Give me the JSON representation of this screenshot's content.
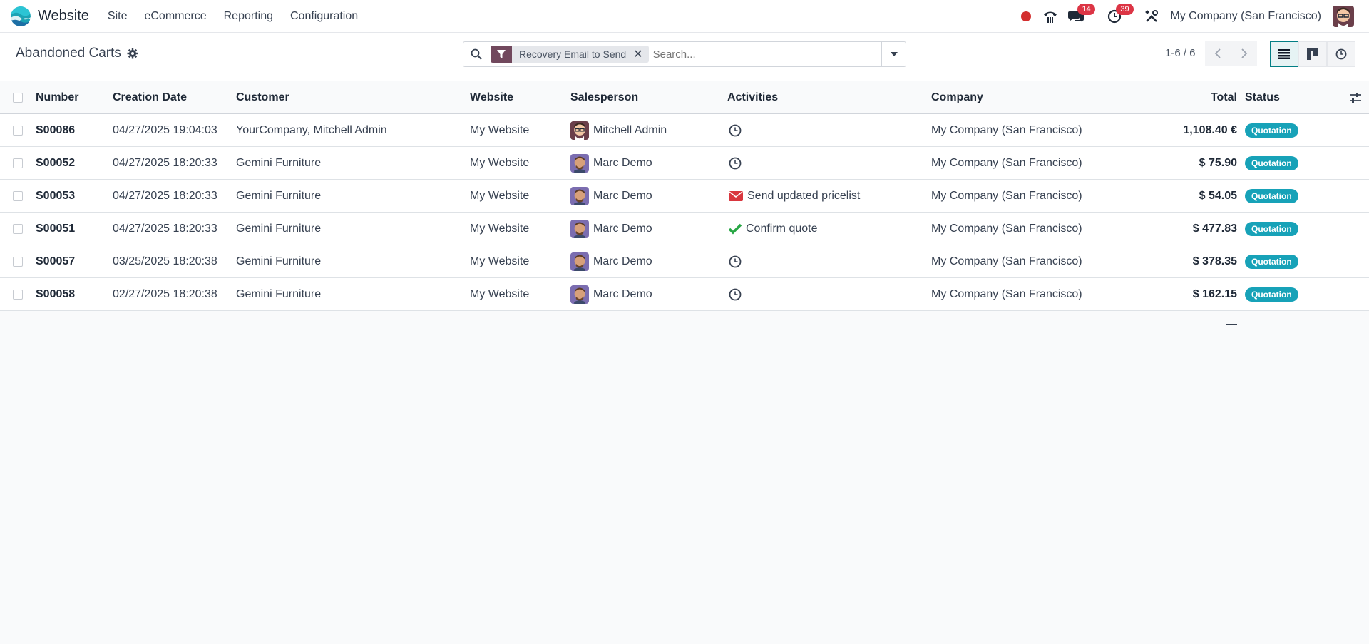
{
  "navbar": {
    "app_name": "Website",
    "menu": [
      "Site",
      "eCommerce",
      "Reporting",
      "Configuration"
    ],
    "messages_count": "14",
    "activities_count": "39",
    "company": "My Company (San Francisco)"
  },
  "control_panel": {
    "title": "Abandoned Carts",
    "facet": "Recovery Email to Send",
    "search_placeholder": "Search...",
    "pager": "1-6 / 6"
  },
  "table": {
    "headers": {
      "number": "Number",
      "creation_date": "Creation Date",
      "customer": "Customer",
      "website": "Website",
      "salesperson": "Salesperson",
      "activities": "Activities",
      "company": "Company",
      "total": "Total",
      "status": "Status"
    },
    "rows": [
      {
        "number": "S00086",
        "date": "04/27/2025 19:04:03",
        "customer": "YourCompany, Mitchell Admin",
        "website": "My Website",
        "salesperson": "Mitchell Admin",
        "avatar": "mitchell",
        "activity_icon": "clock-icon",
        "activity_text": "",
        "company": "My Company (San Francisco)",
        "total": "1,108.40 €",
        "status": "Quotation"
      },
      {
        "number": "S00052",
        "date": "04/27/2025 18:20:33",
        "customer": "Gemini Furniture",
        "website": "My Website",
        "salesperson": "Marc Demo",
        "avatar": "marc",
        "activity_icon": "clock-icon",
        "activity_text": "",
        "company": "My Company (San Francisco)",
        "total": "$ 75.90",
        "status": "Quotation"
      },
      {
        "number": "S00053",
        "date": "04/27/2025 18:20:33",
        "customer": "Gemini Furniture",
        "website": "My Website",
        "salesperson": "Marc Demo",
        "avatar": "marc",
        "activity_icon": "envelope-icon",
        "activity_text": "Send updated pricelist",
        "company": "My Company (San Francisco)",
        "total": "$ 54.05",
        "status": "Quotation"
      },
      {
        "number": "S00051",
        "date": "04/27/2025 18:20:33",
        "customer": "Gemini Furniture",
        "website": "My Website",
        "salesperson": "Marc Demo",
        "avatar": "marc",
        "activity_icon": "check-icon",
        "activity_text": "Confirm quote",
        "company": "My Company (San Francisco)",
        "total": "$ 477.83",
        "status": "Quotation"
      },
      {
        "number": "S00057",
        "date": "03/25/2025 18:20:38",
        "customer": "Gemini Furniture",
        "website": "My Website",
        "salesperson": "Marc Demo",
        "avatar": "marc",
        "activity_icon": "clock-icon",
        "activity_text": "",
        "company": "My Company (San Francisco)",
        "total": "$ 378.35",
        "status": "Quotation"
      },
      {
        "number": "S00058",
        "date": "02/27/2025 18:20:38",
        "customer": "Gemini Furniture",
        "website": "My Website",
        "salesperson": "Marc Demo",
        "avatar": "marc",
        "activity_icon": "clock-icon",
        "activity_text": "",
        "company": "My Company (San Francisco)",
        "total": "$ 162.15",
        "status": "Quotation"
      }
    ]
  },
  "colors": {
    "brand_facet": "#71485d",
    "status_badge": "#17a2b8",
    "badge_red": "#dc3545",
    "envelope_red": "#d9363e",
    "check_green": "#28a745"
  }
}
